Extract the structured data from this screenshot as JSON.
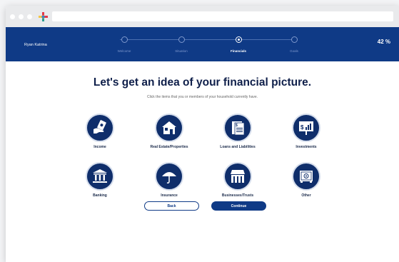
{
  "header": {
    "user_name": "Ryan Katrina",
    "progress_percent": "42 %",
    "steps": [
      {
        "label": "Welcome",
        "active": false
      },
      {
        "label": "Situation",
        "active": false
      },
      {
        "label": "Financials",
        "active": true
      },
      {
        "label": "Goals",
        "active": false
      }
    ]
  },
  "main": {
    "title": "Let's get an idea of your financial picture.",
    "subtitle": "Click the items that you or members of your household currently have.",
    "items": [
      {
        "label": "Income",
        "icon": "hand-money-icon"
      },
      {
        "label": "Real Estate/Properties",
        "icon": "house-icon"
      },
      {
        "label": "Loans and Liabilities",
        "icon": "document-icon"
      },
      {
        "label": "Investments",
        "icon": "chart-board-icon"
      },
      {
        "label": "Banking",
        "icon": "bank-icon"
      },
      {
        "label": "Insurance",
        "icon": "umbrella-icon"
      },
      {
        "label": "Businesses/Trusts",
        "icon": "storefront-icon"
      },
      {
        "label": "Other",
        "icon": "safe-icon"
      }
    ],
    "back_label": "Back",
    "continue_label": "Continue"
  },
  "colors": {
    "brand_navy": "#0f3a86",
    "icon_navy": "#0f2e6b",
    "title_text": "#0f1f4a"
  }
}
